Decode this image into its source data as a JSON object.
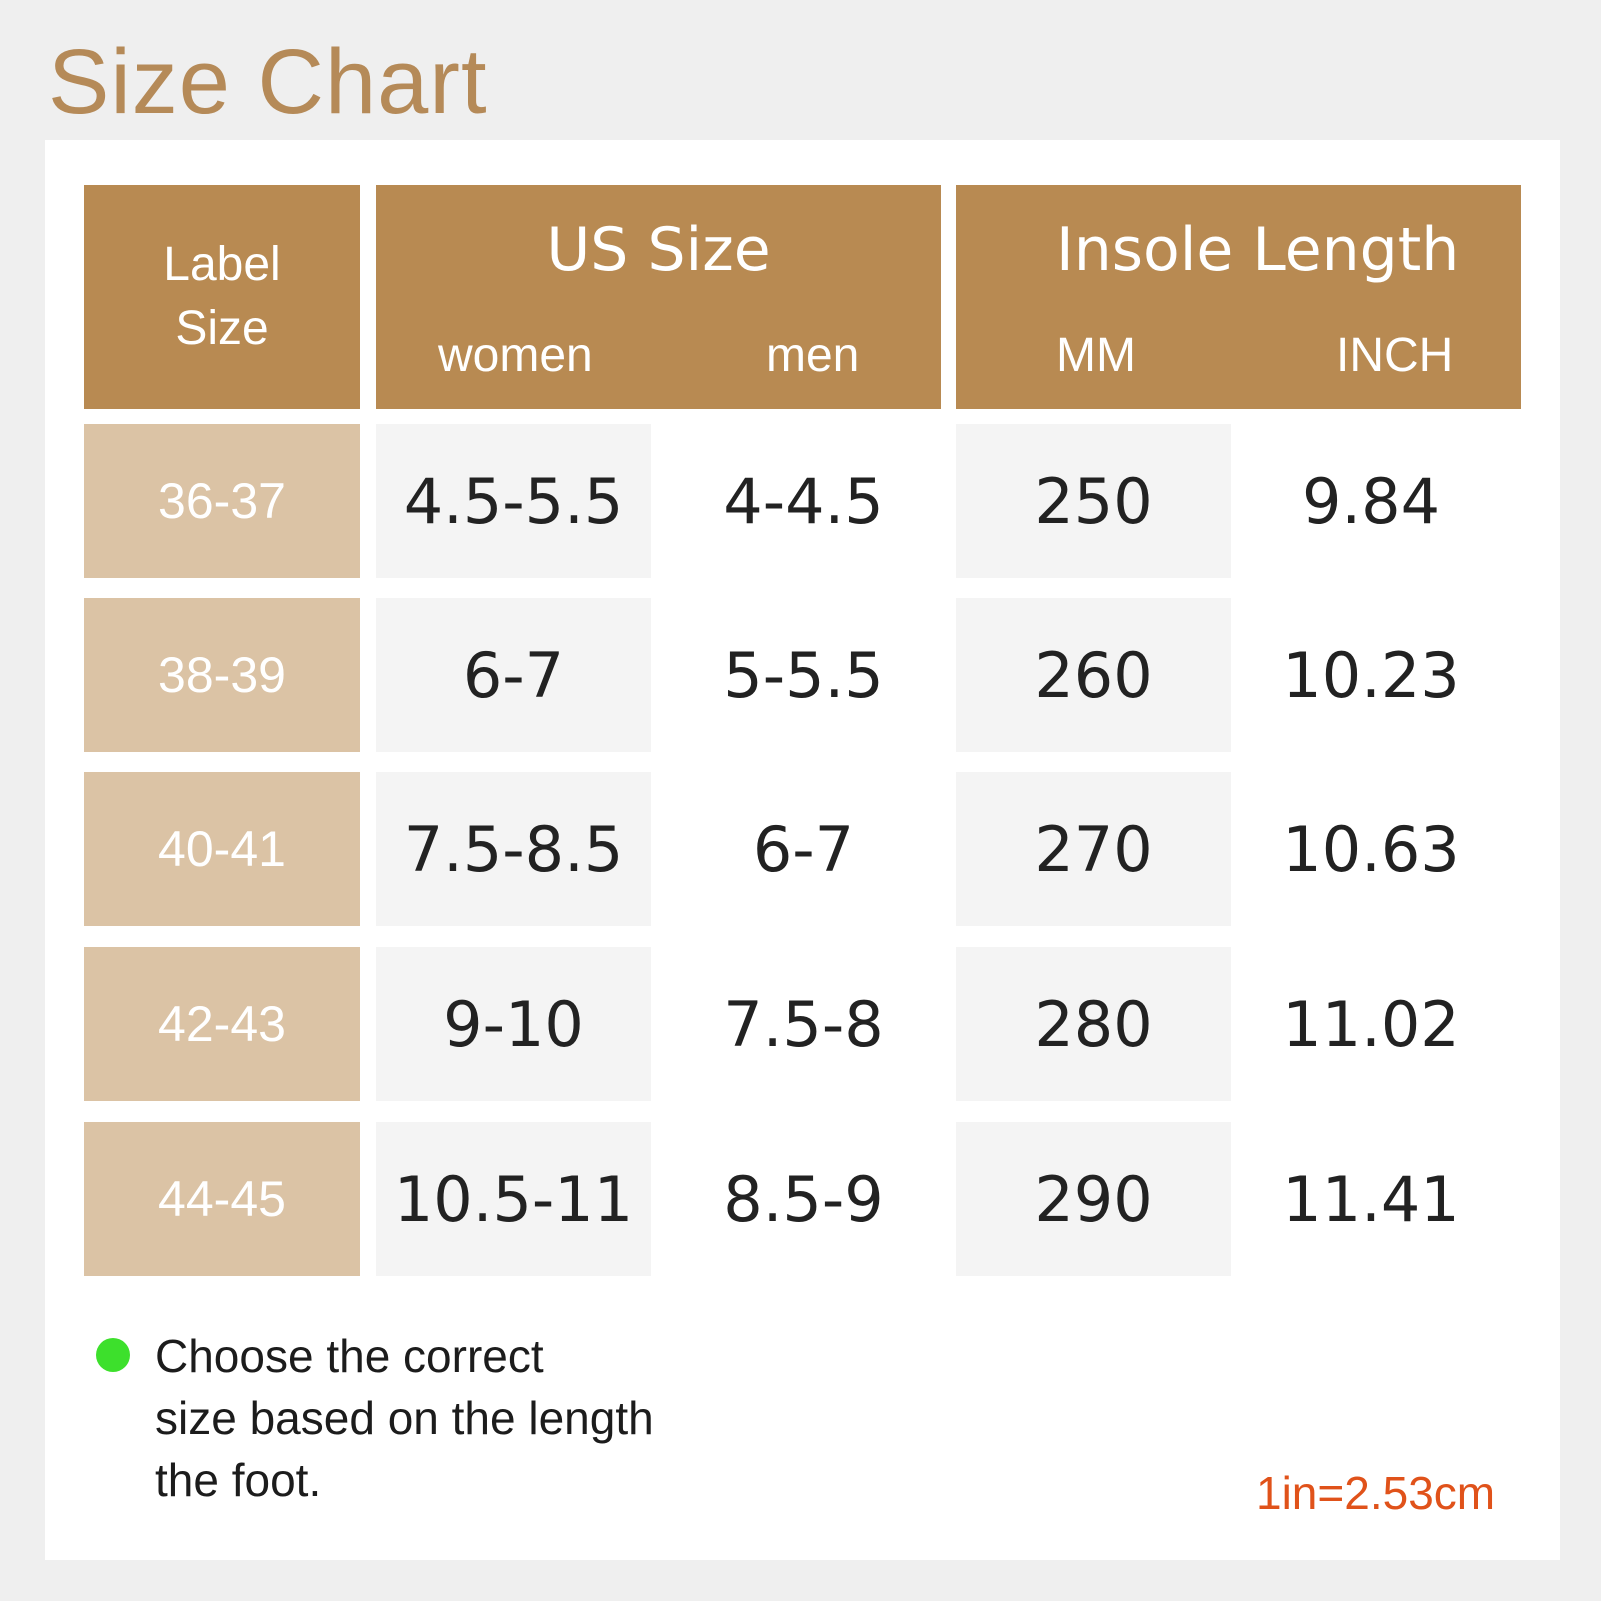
{
  "title": "Size Chart",
  "table": {
    "label_header_line1": "Label",
    "label_header_line2": "Size",
    "us_header": "US Size",
    "us_sub_women": "women",
    "us_sub_men": "men",
    "insole_header": "Insole Length",
    "insole_sub_mm": "MM",
    "insole_sub_inch": "INCH",
    "rows": [
      {
        "label": "36-37",
        "women": "4.5-5.5",
        "men": "4-4.5",
        "mm": "250",
        "inch": "9.84"
      },
      {
        "label": "38-39",
        "women": "6-7",
        "men": "5-5.5",
        "mm": "260",
        "inch": "10.23"
      },
      {
        "label": "40-41",
        "women": "7.5-8.5",
        "men": "6-7",
        "mm": "270",
        "inch": "10.63"
      },
      {
        "label": "42-43",
        "women": "9-10",
        "men": "7.5-8",
        "mm": "280",
        "inch": "11.02"
      },
      {
        "label": "44-45",
        "women": "10.5-11",
        "men": "8.5-9",
        "mm": "290",
        "inch": "11.41"
      }
    ]
  },
  "note": {
    "line1": "Choose the correct",
    "line2": "size based on the length",
    "line3": "the foot."
  },
  "conversion": "1in=2.53cm"
}
